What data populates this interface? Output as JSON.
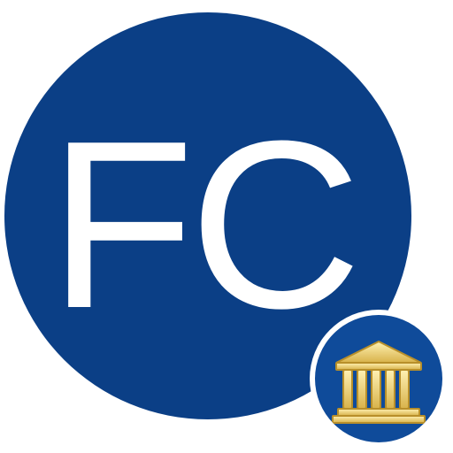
{
  "logo": {
    "monogram": "FC",
    "colors": {
      "circle": "#0b3f86",
      "text": "#ffffff",
      "badge_ring": "#ffffff",
      "badge_fill": "#0f4b9a",
      "building": "#f1dc8b",
      "building_shade": "#b88f2a"
    }
  },
  "badge": {
    "icon": "bank-building-icon"
  }
}
